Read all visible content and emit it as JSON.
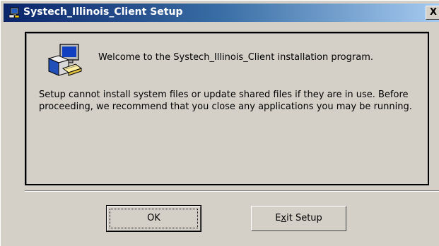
{
  "window": {
    "title": "Systech_Illinois_Client Setup",
    "close_label": "X",
    "title_icon": "setup-computer-icon"
  },
  "content": {
    "welcome": "Welcome to the Systech_Illinois_Client installation program.",
    "message": "Setup cannot install system files or update shared files if they are in use. Before proceeding, we recommend that you close any applications you may be running.",
    "icon": "setup-computer-icon"
  },
  "buttons": {
    "ok_label": "OK",
    "exit_prefix": "E",
    "exit_accel": "x",
    "exit_suffix": "it Setup"
  },
  "colors": {
    "title_gradient_start": "#0a246a",
    "title_gradient_end": "#a6caf0",
    "face": "#d4d0c8"
  }
}
